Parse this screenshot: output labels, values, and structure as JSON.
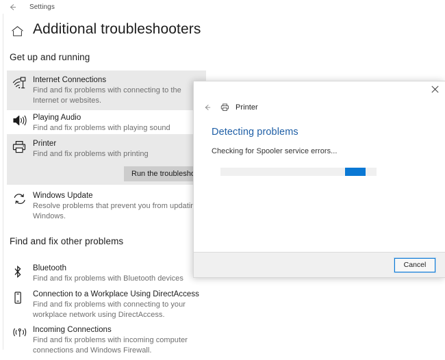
{
  "settings_window": {
    "titlebar": {
      "back_arrow_icon": "back-arrow-icon",
      "title": "Settings"
    },
    "home_icon": "home-icon",
    "page_title": "Additional troubleshooters",
    "sections": [
      {
        "heading": "Get up and running",
        "items": [
          {
            "icon": "internet-connections-icon",
            "name": "Internet Connections",
            "description": "Find and fix problems with connecting to the Internet or websites.",
            "selected": true
          },
          {
            "icon": "playing-audio-icon",
            "name": "Playing Audio",
            "description": "Find and fix problems with playing sound",
            "selected": false
          },
          {
            "icon": "printer-icon",
            "name": "Printer",
            "description": "Find and fix problems with printing",
            "selected": true
          },
          {
            "icon": "windows-update-icon",
            "name": "Windows Update",
            "description": "Resolve problems that prevent you from updating Windows.",
            "selected": false
          }
        ]
      },
      {
        "heading": "Find and fix other problems",
        "items": [
          {
            "icon": "bluetooth-icon",
            "name": "Bluetooth",
            "description": "Find and fix problems with Bluetooth devices",
            "selected": false
          },
          {
            "icon": "workplace-device-icon",
            "name": "Connection to a Workplace Using DirectAccess",
            "description": "Find and fix problems with connecting to your workplace network using DirectAccess.",
            "selected": false
          },
          {
            "icon": "incoming-connections-icon",
            "name": "Incoming Connections",
            "description": "Find and fix problems with incoming computer connections and Windows Firewall.",
            "selected": false
          }
        ]
      }
    ],
    "run_troubleshooter_button": "Run the troubleshooter"
  },
  "printer_dialog": {
    "close_icon": "close-icon",
    "back_icon": "back-arrow-icon",
    "header_icon": "printer-icon",
    "header_title": "Printer",
    "heading": "Detecting problems",
    "heading_color": "#1f5fa6",
    "status_text": "Checking for Spooler service errors...",
    "progress": {
      "style": "marquee",
      "accent_color": "#0a78d4",
      "track_color": "#f0f0f0",
      "chunk_left_pct": 80,
      "chunk_width_pct": 13
    },
    "cancel_button": "Cancel"
  }
}
